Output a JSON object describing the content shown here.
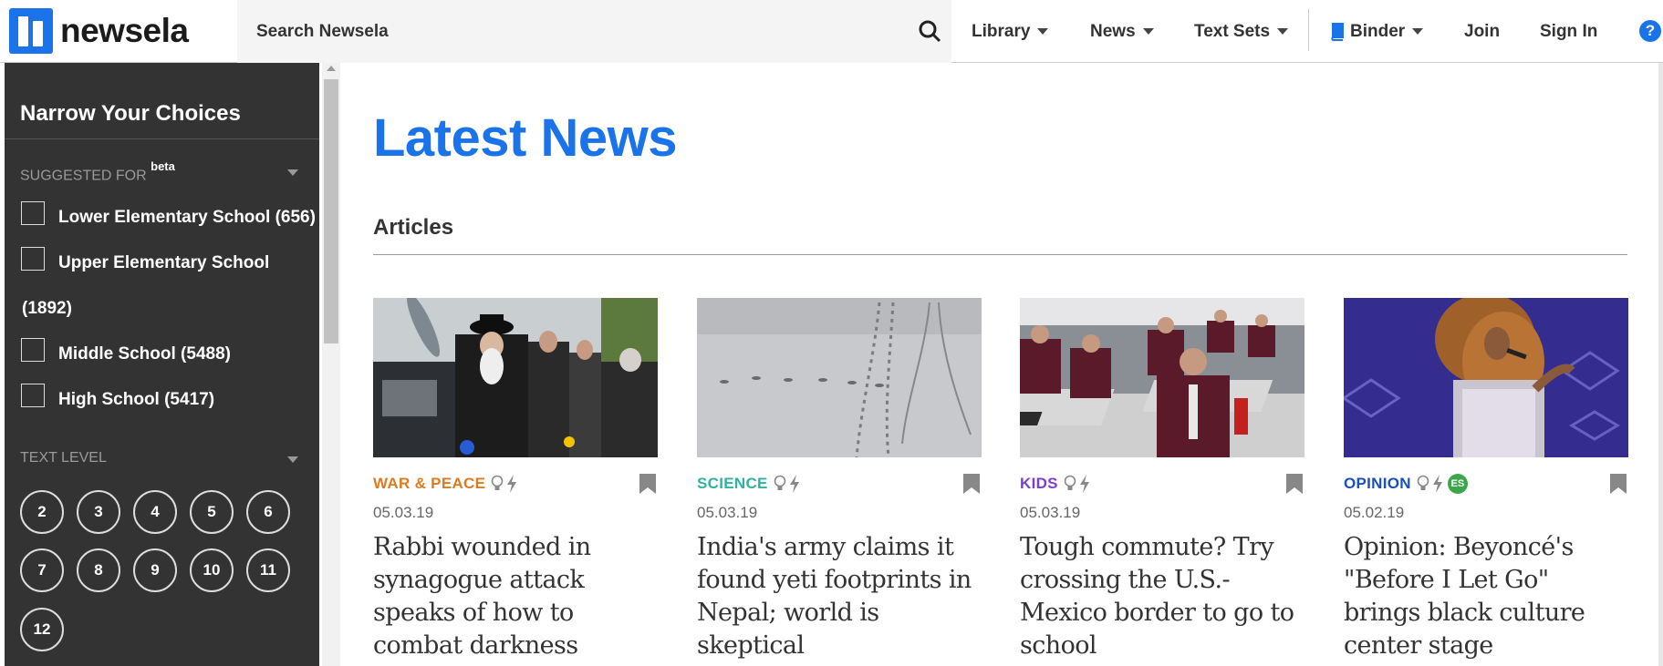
{
  "brand": {
    "name": "newsela",
    "color": "#1a73e8"
  },
  "search": {
    "placeholder": "Search Newsela"
  },
  "nav": {
    "library": "Library",
    "news": "News",
    "text_sets": "Text Sets",
    "binder": "Binder",
    "join": "Join",
    "sign_in": "Sign In",
    "help": "?"
  },
  "sidebar": {
    "title": "Narrow Your Choices",
    "suggested": {
      "title": "SUGGESTED FOR",
      "badge": "beta",
      "options": [
        {
          "label": "Lower Elementary School (656)"
        },
        {
          "label": "Upper Elementary School",
          "label_cont": "(1892)"
        },
        {
          "label": "Middle School (5488)"
        },
        {
          "label": "High School (5417)"
        }
      ]
    },
    "text_level": {
      "title": "TEXT LEVEL",
      "levels": [
        "2",
        "3",
        "4",
        "5",
        "6",
        "7",
        "8",
        "9",
        "10",
        "11",
        "12"
      ]
    }
  },
  "main": {
    "title": "Latest News",
    "section": "Articles",
    "articles": [
      {
        "category": "WAR & PEACE",
        "cat_color": "#e07a1f",
        "date": "05.03.19",
        "headline": "Rabbi wounded in synagogue attack speaks of how to combat darkness",
        "image_icon": "photo-rabbi-icon"
      },
      {
        "category": "SCIENCE",
        "cat_color": "#2fb3a0",
        "date": "05.03.19",
        "headline": "India's army claims it found yeti footprints in Nepal; world is skeptical",
        "image_icon": "photo-snow-footprints-icon"
      },
      {
        "category": "KIDS",
        "cat_color": "#7a3fd1",
        "date": "05.03.19",
        "headline": "Tough commute? Try crossing the U.S.-Mexico border to go to school",
        "image_icon": "photo-classroom-icon"
      },
      {
        "category": "OPINION",
        "cat_color": "#1a4fbf",
        "date": "05.02.19",
        "headline": "Opinion: Beyoncé's \"Before I Let Go\" brings black culture center stage",
        "image_icon": "photo-singer-icon",
        "badge": "ES"
      }
    ]
  }
}
